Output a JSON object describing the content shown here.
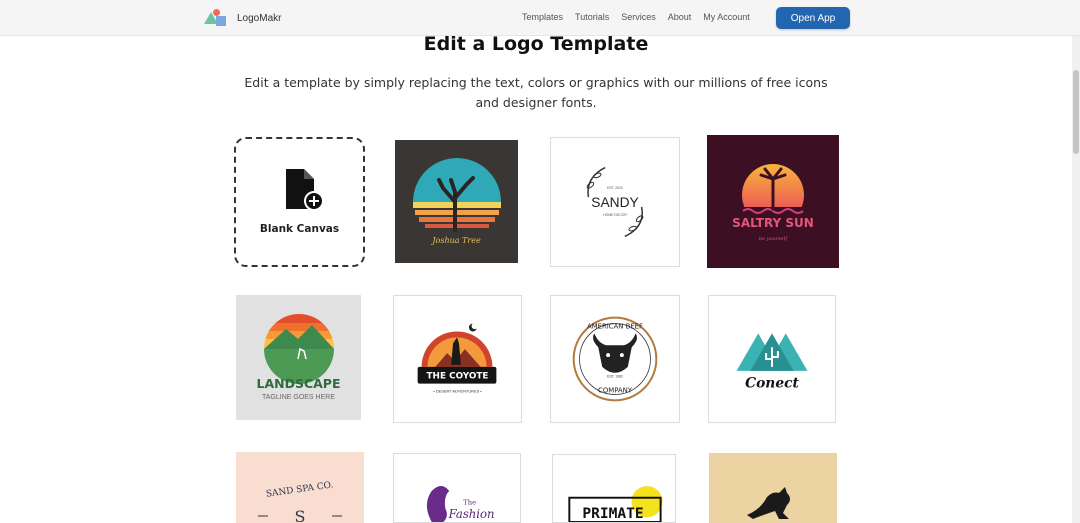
{
  "header": {
    "brand": "LogoMakr",
    "nav": [
      "Templates",
      "Tutorials",
      "Services",
      "About",
      "My Account"
    ],
    "cta_label": "Open App"
  },
  "main": {
    "title": "Edit a Logo Template",
    "subtitle": "Edit a template by simply replacing the text, colors or graphics with our millions of free icons and designer fonts.",
    "blank_canvas_label": "Blank Canvas",
    "templates": [
      {
        "name": "Joshua Tree",
        "lines": [
          "Joshua Tree"
        ]
      },
      {
        "name": "Sandy",
        "lines": [
          "SANDY",
          "EST. 2020",
          "HOME DECOR"
        ]
      },
      {
        "name": "Saltry Sun",
        "lines": [
          "SALTRY SUN",
          "be yourself"
        ]
      },
      {
        "name": "Landscape",
        "lines": [
          "LANDSCAPE",
          "TAGLINE GOES HERE"
        ]
      },
      {
        "name": "The Coyote",
        "lines": [
          "THE COYOTE",
          "• DESERT ADVENTURES •"
        ]
      },
      {
        "name": "American Beef",
        "lines": [
          "AMERICAN BEEF",
          "COMPANY",
          "EST. 1982"
        ]
      },
      {
        "name": "Conect",
        "lines": [
          "Conect"
        ]
      },
      {
        "name": "Sand Spa Co.",
        "lines": [
          "SAND SPA CO.",
          "S"
        ]
      },
      {
        "name": "The Fashion",
        "lines": [
          "The",
          "Fashion"
        ]
      },
      {
        "name": "Primate",
        "lines": [
          "PRIMATE"
        ]
      },
      {
        "name": "Kangaroo",
        "lines": []
      }
    ]
  },
  "colors": {
    "accent": "#2366b0",
    "topbar_bg": "#f5f5f6"
  }
}
